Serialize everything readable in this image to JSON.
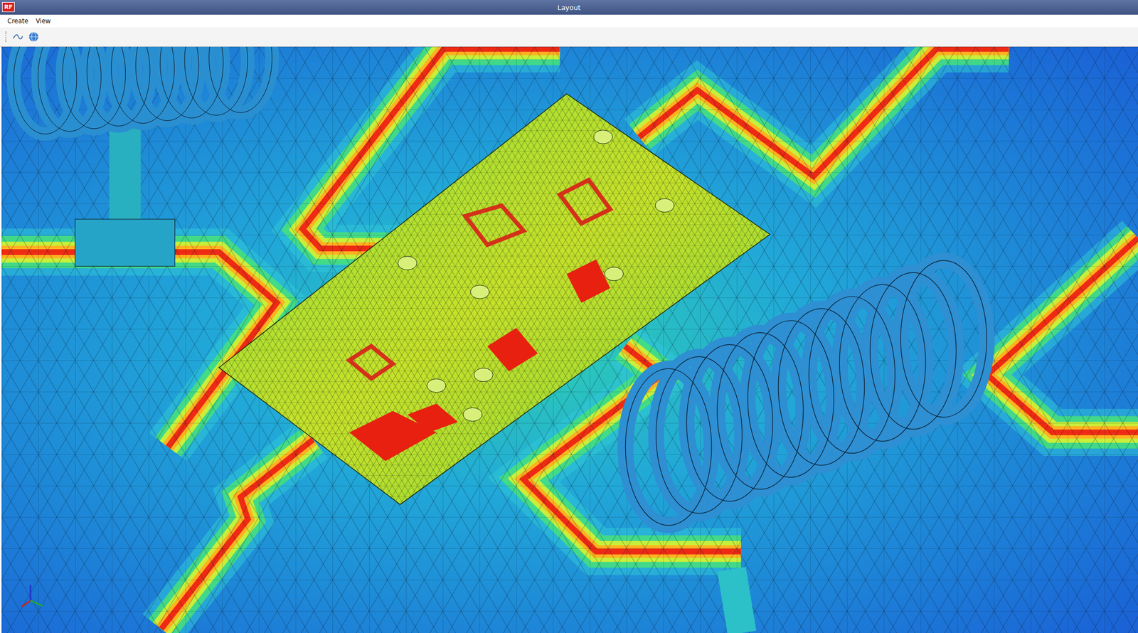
{
  "window": {
    "title": "Layout",
    "logo": "RF"
  },
  "menus": [
    {
      "label": "Create"
    },
    {
      "label": "View"
    }
  ]
}
